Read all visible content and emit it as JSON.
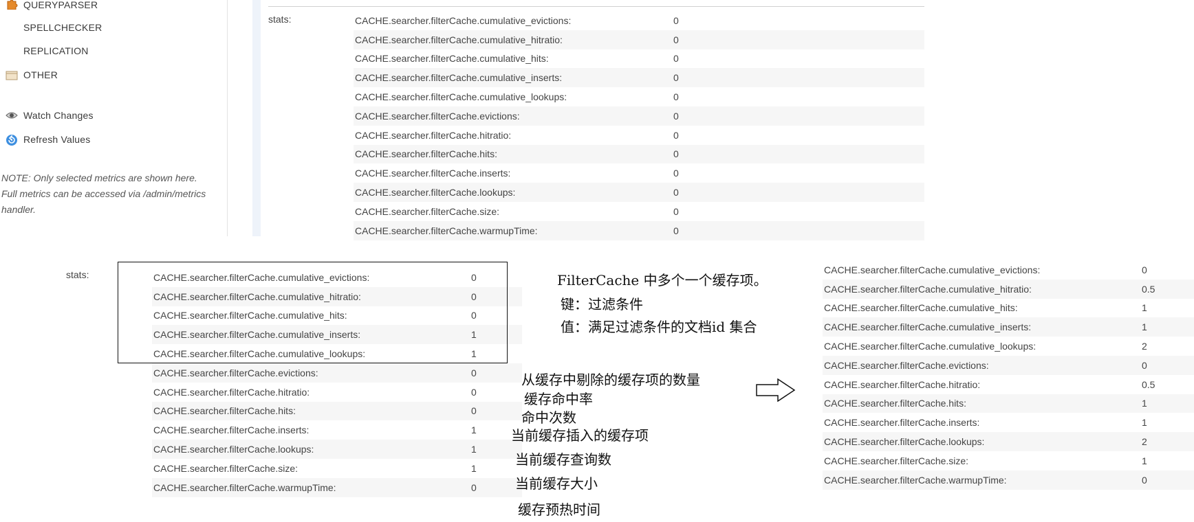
{
  "sidebar": {
    "items": [
      {
        "label": "QUERYPARSER",
        "icon": "puzzle-icon"
      },
      {
        "label": "SPELLCHECKER",
        "icon": ""
      },
      {
        "label": "REPLICATION",
        "icon": ""
      },
      {
        "label": "OTHER",
        "icon": "folder-icon"
      }
    ],
    "watch_changes": "Watch Changes",
    "refresh_values": "Refresh Values",
    "note": "NOTE: Only selected metrics are shown here. Full metrics can be accessed via /admin/metrics handler."
  },
  "top_panel": {
    "stats_label": "stats:",
    "rows": [
      {
        "key": "CACHE.searcher.filterCache.cumulative_evictions:",
        "value": "0"
      },
      {
        "key": "CACHE.searcher.filterCache.cumulative_hitratio:",
        "value": "0"
      },
      {
        "key": "CACHE.searcher.filterCache.cumulative_hits:",
        "value": "0"
      },
      {
        "key": "CACHE.searcher.filterCache.cumulative_inserts:",
        "value": "0"
      },
      {
        "key": "CACHE.searcher.filterCache.cumulative_lookups:",
        "value": "0"
      },
      {
        "key": "CACHE.searcher.filterCache.evictions:",
        "value": "0"
      },
      {
        "key": "CACHE.searcher.filterCache.hitratio:",
        "value": "0"
      },
      {
        "key": "CACHE.searcher.filterCache.hits:",
        "value": "0"
      },
      {
        "key": "CACHE.searcher.filterCache.inserts:",
        "value": "0"
      },
      {
        "key": "CACHE.searcher.filterCache.lookups:",
        "value": "0"
      },
      {
        "key": "CACHE.searcher.filterCache.size:",
        "value": "0"
      },
      {
        "key": "CACHE.searcher.filterCache.warmupTime:",
        "value": "0"
      }
    ]
  },
  "bottom_panel": {
    "stats_label": "stats:",
    "rows": [
      {
        "key": "CACHE.searcher.filterCache.cumulative_evictions:",
        "value": "0"
      },
      {
        "key": "CACHE.searcher.filterCache.cumulative_hitratio:",
        "value": "0"
      },
      {
        "key": "CACHE.searcher.filterCache.cumulative_hits:",
        "value": "0"
      },
      {
        "key": "CACHE.searcher.filterCache.cumulative_inserts:",
        "value": "1"
      },
      {
        "key": "CACHE.searcher.filterCache.cumulative_lookups:",
        "value": "1"
      },
      {
        "key": "CACHE.searcher.filterCache.evictions:",
        "value": "0"
      },
      {
        "key": "CACHE.searcher.filterCache.hitratio:",
        "value": "0"
      },
      {
        "key": "CACHE.searcher.filterCache.hits:",
        "value": "0"
      },
      {
        "key": "CACHE.searcher.filterCache.inserts:",
        "value": "1"
      },
      {
        "key": "CACHE.searcher.filterCache.lookups:",
        "value": "1"
      },
      {
        "key": "CACHE.searcher.filterCache.size:",
        "value": "1"
      },
      {
        "key": "CACHE.searcher.filterCache.warmupTime:",
        "value": "0"
      }
    ]
  },
  "annotations": {
    "title": "FilterCache 中多个一个缓存项。",
    "key_line": "键：过滤条件",
    "value_line": "值：满足过滤条件的文档id 集合",
    "evictions": "从缓存中剔除的缓存项的数量",
    "hitratio": "缓存命中率",
    "hits": "命中次数",
    "inserts": "当前缓存插入的缓存项",
    "lookups": "当前缓存查询数",
    "size": "当前缓存大小",
    "warmup": "缓存预热时间"
  },
  "right_panel": {
    "rows": [
      {
        "key": "CACHE.searcher.filterCache.cumulative_evictions:",
        "value": "0"
      },
      {
        "key": "CACHE.searcher.filterCache.cumulative_hitratio:",
        "value": "0.5"
      },
      {
        "key": "CACHE.searcher.filterCache.cumulative_hits:",
        "value": "1"
      },
      {
        "key": "CACHE.searcher.filterCache.cumulative_inserts:",
        "value": "1"
      },
      {
        "key": "CACHE.searcher.filterCache.cumulative_lookups:",
        "value": "2"
      },
      {
        "key": "CACHE.searcher.filterCache.evictions:",
        "value": "0"
      },
      {
        "key": "CACHE.searcher.filterCache.hitratio:",
        "value": "0.5"
      },
      {
        "key": "CACHE.searcher.filterCache.hits:",
        "value": "1"
      },
      {
        "key": "CACHE.searcher.filterCache.inserts:",
        "value": "1"
      },
      {
        "key": "CACHE.searcher.filterCache.lookups:",
        "value": "2"
      },
      {
        "key": "CACHE.searcher.filterCache.size:",
        "value": "1"
      },
      {
        "key": "CACHE.searcher.filterCache.warmupTime:",
        "value": "0"
      }
    ]
  }
}
